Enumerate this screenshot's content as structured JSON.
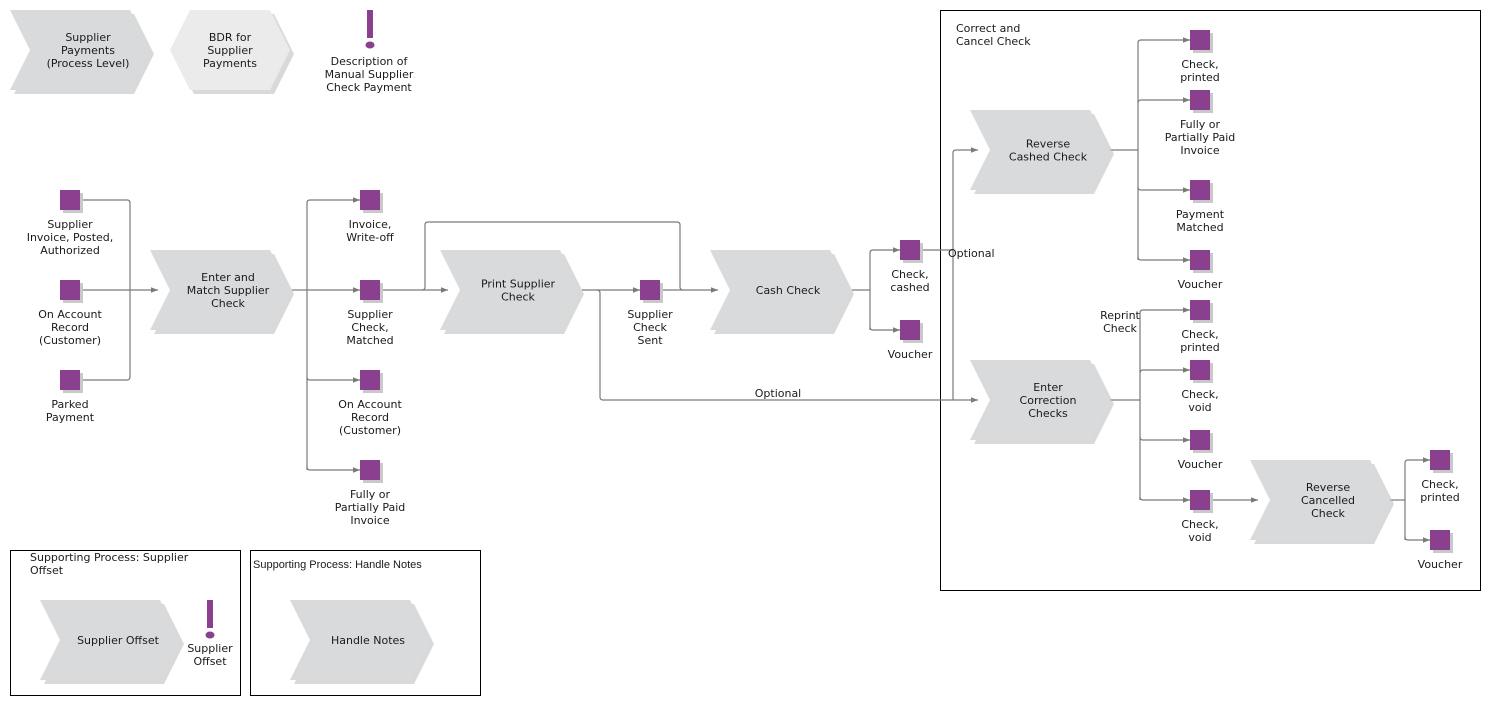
{
  "colors": {
    "function_fill": "#d9dadb",
    "process_interface_fill": "#ebebeb",
    "event_fill": "#8a3f8f",
    "connector": "#7a7a7a",
    "frame": "#000000"
  },
  "header_items": {
    "process_level": {
      "lines": [
        "Supplier",
        "Payments",
        "(Process Level)"
      ]
    },
    "bdr": {
      "lines": [
        "BDR for",
        "Supplier",
        "Payments"
      ]
    },
    "description": {
      "icon": "exclamation-icon",
      "lines": [
        "Description of",
        "Manual Supplier",
        "Check Payment"
      ]
    }
  },
  "inputs": [
    {
      "lines": [
        "Supplier",
        "Invoice, Posted,",
        "Authorized"
      ]
    },
    {
      "lines": [
        "On Account",
        "Record",
        "(Customer)"
      ]
    },
    {
      "lines": [
        "Parked",
        "Payment"
      ]
    }
  ],
  "functions": {
    "enter_match": {
      "lines": [
        "Enter and",
        "Match Supplier",
        "Check"
      ]
    },
    "print_check": {
      "lines": [
        "Print Supplier",
        "Check"
      ]
    },
    "cash_check": {
      "lines": [
        "Cash Check"
      ]
    },
    "reverse_cashed": {
      "lines": [
        "Reverse",
        "Cashed Check"
      ]
    },
    "enter_correction": {
      "lines": [
        "Enter",
        "Correction",
        "Checks"
      ]
    },
    "reverse_cancelled": {
      "lines": [
        "Reverse",
        "Cancelled",
        "Check"
      ]
    },
    "supplier_offset": {
      "lines": [
        "Supplier Offset"
      ]
    },
    "handle_notes": {
      "lines": [
        "Handle Notes"
      ]
    }
  },
  "match_outputs": [
    {
      "lines": [
        "Invoice,",
        "Write-off"
      ]
    },
    {
      "lines": [
        "Supplier",
        "Check,",
        "Matched"
      ]
    },
    {
      "lines": [
        "On Account",
        "Record",
        "(Customer)"
      ]
    },
    {
      "lines": [
        "Fully or",
        "Partially Paid",
        "Invoice"
      ]
    }
  ],
  "print_output": {
    "lines": [
      "Supplier",
      "Check",
      "Sent"
    ]
  },
  "cash_outputs": [
    {
      "lines": [
        "Check,",
        "cashed"
      ]
    },
    {
      "lines": [
        "Voucher"
      ]
    }
  ],
  "connector_labels": {
    "optional_top": "Optional",
    "optional_bottom": "Optional",
    "reprint": [
      "Reprint",
      "Check"
    ]
  },
  "correct_cancel_group": {
    "title_lines": [
      "Correct and",
      "Cancel Check"
    ],
    "reverse_cashed_outputs": [
      {
        "lines": [
          "Check,",
          "printed"
        ]
      },
      {
        "lines": [
          "Fully or",
          "Partially Paid",
          "Invoice"
        ]
      },
      {
        "lines": [
          "Payment",
          "Matched"
        ]
      },
      {
        "lines": [
          "Voucher"
        ]
      }
    ],
    "correction_outputs": [
      {
        "lines": [
          "Check,",
          "printed"
        ]
      },
      {
        "lines": [
          "Check,",
          "void"
        ]
      },
      {
        "lines": [
          "Voucher"
        ]
      },
      {
        "lines": [
          "Check,",
          "void"
        ]
      }
    ],
    "reverse_cancelled_outputs": [
      {
        "lines": [
          "Check,",
          "printed"
        ]
      },
      {
        "lines": [
          "Voucher"
        ]
      }
    ]
  },
  "supporting_offset": {
    "title_lines": [
      "Supporting Process: Supplier",
      "Offset"
    ],
    "note": {
      "icon": "exclamation-icon",
      "lines": [
        "Supplier",
        "Offset"
      ]
    }
  },
  "supporting_notes": {
    "title": "Supporting Process: Handle Notes"
  }
}
